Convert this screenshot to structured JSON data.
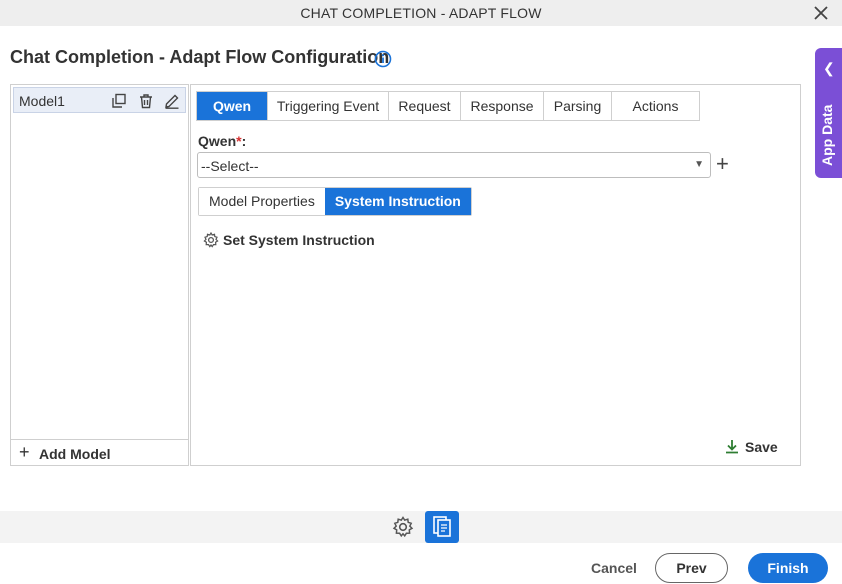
{
  "window": {
    "title": "CHAT COMPLETION - ADAPT FLOW"
  },
  "page": {
    "title": "Chat Completion - Adapt Flow Configuration"
  },
  "app_data_tab": {
    "label": "App Data"
  },
  "models": [
    {
      "name": "Model1"
    }
  ],
  "add_model_label": "Add Model",
  "tabs": [
    {
      "label": "Qwen",
      "active": true
    },
    {
      "label": "Triggering Event",
      "active": false
    },
    {
      "label": "Request",
      "active": false
    },
    {
      "label": "Response",
      "active": false
    },
    {
      "label": "Parsing",
      "active": false
    },
    {
      "label": "Actions",
      "active": false
    }
  ],
  "qwen_field": {
    "label": "Qwen",
    "required_mark": "*",
    "colon": ":",
    "value": "--Select--"
  },
  "subtabs": [
    {
      "label": "Model Properties",
      "active": false
    },
    {
      "label": "System Instruction",
      "active": true
    }
  ],
  "set_system_instruction_label": "Set System Instruction",
  "save_label": "Save",
  "footer": {
    "cancel": "Cancel",
    "prev": "Prev",
    "finish": "Finish"
  },
  "colors": {
    "accent": "#1a73d9",
    "app_data": "#7b4fd6",
    "required": "#d32f2f"
  },
  "icons": [
    "close-icon",
    "info-icon",
    "chevron-left-icon",
    "duplicate-icon",
    "delete-icon",
    "edit-icon",
    "plus-icon",
    "caret-down-icon",
    "gear-icon",
    "download-icon",
    "document-icon"
  ]
}
